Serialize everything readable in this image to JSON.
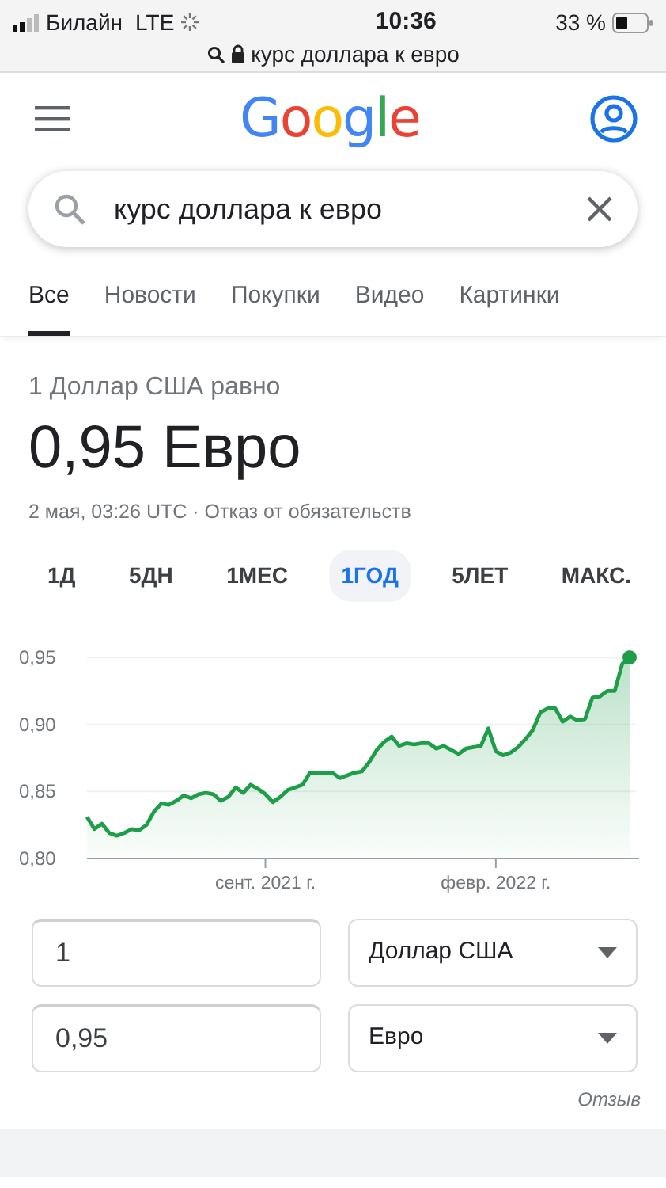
{
  "status_bar": {
    "carrier": "Билайн",
    "network": "LTE",
    "time": "10:36",
    "battery": "33 %"
  },
  "address_bar": {
    "text": "курс доллара к евро"
  },
  "header": {
    "logo": "Google"
  },
  "search": {
    "value": "курс доллара к евро"
  },
  "tabs": [
    {
      "label": "Все",
      "selected": true
    },
    {
      "label": "Новости",
      "selected": false
    },
    {
      "label": "Покупки",
      "selected": false
    },
    {
      "label": "Видео",
      "selected": false
    },
    {
      "label": "Картинки",
      "selected": false
    }
  ],
  "result": {
    "subtitle": "1 Доллар США равно",
    "value": "0,95 Евро",
    "timestamp": "2 мая, 03:26 UTC · ",
    "disclaimer": "Отказ от обязательств"
  },
  "ranges": [
    {
      "label": "1Д",
      "selected": false
    },
    {
      "label": "5ДН",
      "selected": false
    },
    {
      "label": "1МЕС",
      "selected": false
    },
    {
      "label": "1ГОД",
      "selected": true
    },
    {
      "label": "5ЛЕТ",
      "selected": false
    },
    {
      "label": "МАКС.",
      "selected": false
    }
  ],
  "chart_data": {
    "type": "area",
    "ylim": [
      0.8,
      0.95
    ],
    "yticks": [
      {
        "value": 0.8,
        "label": "0,80"
      },
      {
        "value": 0.85,
        "label": "0,85"
      },
      {
        "value": 0.9,
        "label": "0,90"
      },
      {
        "value": 0.95,
        "label": "0,95"
      }
    ],
    "categories": [
      null,
      null,
      null,
      null,
      null,
      null,
      null,
      null,
      null,
      null,
      null,
      null,
      null,
      null,
      null,
      null,
      null,
      null,
      null,
      null,
      null,
      null,
      null,
      null,
      "сент. 2021 г.",
      null,
      null,
      null,
      null,
      null,
      null,
      null,
      null,
      null,
      null,
      null,
      null,
      null,
      null,
      null,
      null,
      null,
      null,
      null,
      null,
      null,
      null,
      null,
      null,
      null,
      null,
      null,
      null,
      null,
      null,
      "февр. 2022 г.",
      null,
      null,
      null,
      null,
      null,
      null,
      null,
      null,
      null,
      null,
      null,
      null,
      null,
      null,
      null,
      null,
      null,
      null
    ],
    "series": [
      {
        "color": "#1e9e49",
        "values": [
          0.831,
          0.822,
          0.826,
          0.819,
          0.817,
          0.819,
          0.822,
          0.821,
          0.825,
          0.835,
          0.841,
          0.84,
          0.843,
          0.847,
          0.845,
          0.848,
          0.849,
          0.848,
          0.843,
          0.846,
          0.853,
          0.849,
          0.855,
          0.852,
          0.848,
          0.842,
          0.846,
          0.851,
          0.853,
          0.855,
          0.864,
          0.864,
          0.864,
          0.864,
          0.86,
          0.862,
          0.864,
          0.865,
          0.872,
          0.881,
          0.887,
          0.891,
          0.884,
          0.886,
          0.885,
          0.886,
          0.886,
          0.882,
          0.884,
          0.881,
          0.878,
          0.882,
          0.883,
          0.884,
          0.897,
          0.88,
          0.877,
          0.879,
          0.883,
          0.889,
          0.896,
          0.909,
          0.912,
          0.912,
          0.902,
          0.906,
          0.903,
          0.904,
          0.92,
          0.921,
          0.925,
          0.925,
          0.945,
          0.95
        ]
      }
    ]
  },
  "converter": {
    "rows": [
      {
        "amount": "1",
        "currency": "Доллар США"
      },
      {
        "amount": "0,95",
        "currency": "Евро"
      }
    ],
    "feedback": "Отзыв"
  }
}
